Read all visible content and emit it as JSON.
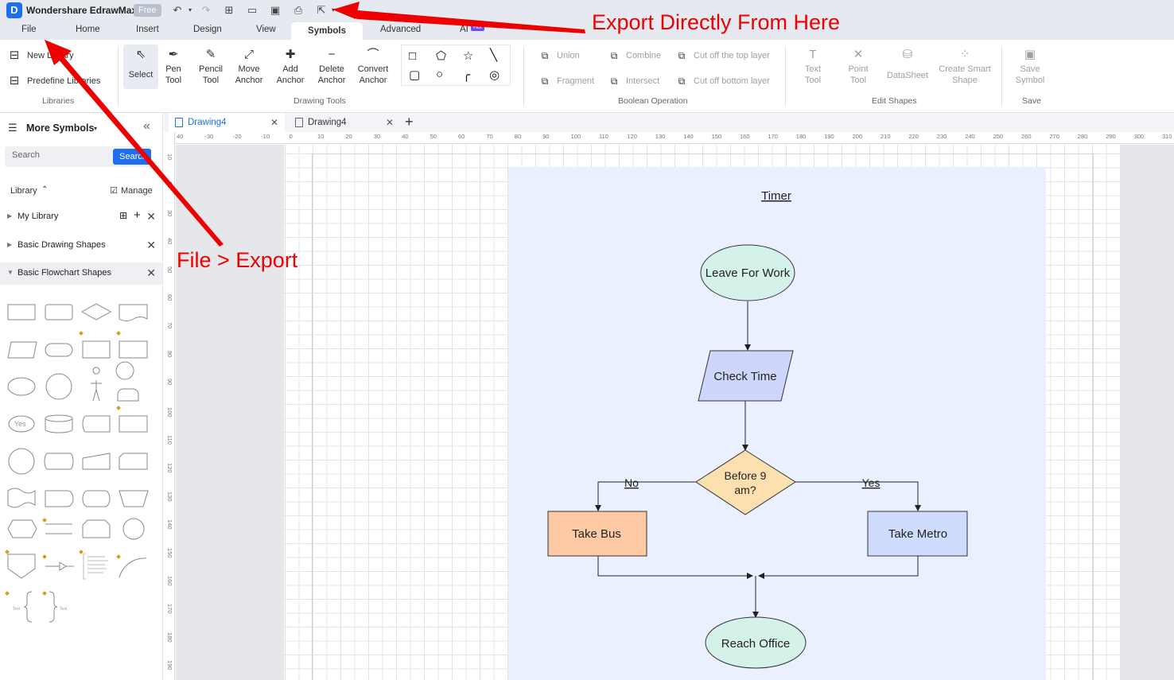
{
  "app": {
    "title": "Wondershare EdrawMax",
    "badge": "Free",
    "logo": "D"
  },
  "menu": {
    "tabs": [
      "File",
      "Home",
      "Insert",
      "Design",
      "View",
      "Symbols",
      "Advanced",
      "AI"
    ],
    "active": "Symbols",
    "ai_badge": "Hot"
  },
  "ribbon": {
    "libraries": {
      "new_library": "New Library",
      "predefine_libraries": "Predefine Libraries",
      "label": "Libraries"
    },
    "drawing_tools": {
      "select": "Select",
      "pen": [
        "Pen",
        "Tool"
      ],
      "pencil": [
        "Pencil",
        "Tool"
      ],
      "move_anchor": [
        "Move",
        "Anchor"
      ],
      "add_anchor": [
        "Add",
        "Anchor"
      ],
      "delete_anchor": [
        "Delete",
        "Anchor"
      ],
      "convert_anchor": [
        "Convert",
        "Anchor"
      ],
      "label": "Drawing Tools"
    },
    "boolean": {
      "union": "Union",
      "combine": "Combine",
      "cut_top": "Cut off the top layer",
      "fragment": "Fragment",
      "intersect": "Intersect",
      "cut_bottom": "Cut off bottom layer",
      "label": "Boolean Operation"
    },
    "edit_shapes": {
      "text_tool": [
        "Text",
        "Tool"
      ],
      "point_tool": [
        "Point",
        "Tool"
      ],
      "datasheet": "DataSheet",
      "smart_shape": [
        "Create Smart",
        "Shape"
      ],
      "label": "Edit Shapes"
    },
    "save": {
      "save_symbol": [
        "Save",
        "Symbol"
      ],
      "label": "Save"
    }
  },
  "sidebar": {
    "title": "More Symbols",
    "search_placeholder": "Search",
    "search_button": "Search",
    "library_label": "Library",
    "manage_label": "Manage",
    "items": [
      "My Library",
      "Basic Drawing Shapes",
      "Basic Flowchart Shapes"
    ]
  },
  "doc_tabs": [
    "Drawing4",
    "Drawing4"
  ],
  "ruler": {
    "top": [
      "40",
      "-30",
      "-20",
      "-10",
      "0",
      "10",
      "20",
      "30",
      "40",
      "50",
      "60",
      "70",
      "80",
      "90",
      "100",
      "110",
      "120",
      "130",
      "140",
      "150",
      "160",
      "170",
      "180",
      "190",
      "200",
      "210",
      "220",
      "230",
      "240",
      "250",
      "260",
      "270",
      "280",
      "290",
      "300",
      "310"
    ],
    "left": [
      "10",
      "20",
      "30",
      "40",
      "50",
      "60",
      "70",
      "80",
      "90",
      "100",
      "110",
      "120",
      "130",
      "140",
      "150",
      "160",
      "170",
      "180",
      "190"
    ]
  },
  "flowchart": {
    "title": "Timer",
    "nodes": {
      "start": "Leave For Work",
      "check": "Check Time",
      "decision_line1": "Before 9",
      "decision_line2": "am?",
      "bus": "Take Bus",
      "metro": "Take Metro",
      "end": "Reach Office"
    },
    "edge_labels": {
      "no": "No",
      "yes": "Yes"
    },
    "colors": {
      "start": "#d5f2ea",
      "check": "#cfd6fb",
      "decision": "#fde0b0",
      "bus": "#fdcaa5",
      "metro": "#cfdcfd",
      "end": "#d5f2ea"
    }
  },
  "annotations": {
    "export_here": "Export Directly From Here",
    "file_export": "File > Export",
    "color": "#ee0000"
  },
  "icons": [
    "undo-icon",
    "redo-icon",
    "new-icon",
    "open-icon",
    "save-icon",
    "print-icon",
    "export-icon"
  ]
}
